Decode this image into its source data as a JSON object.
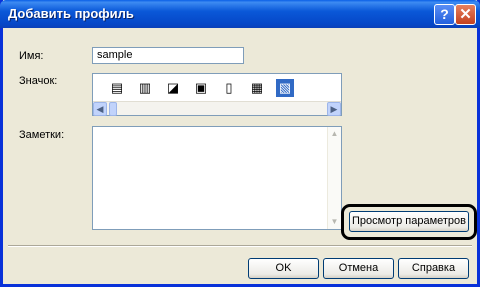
{
  "window": {
    "title": "Добавить профиль",
    "help_glyph": "?",
    "close_glyph": "✕"
  },
  "form": {
    "name_label": "Имя:",
    "name_value": "sample",
    "icon_label": "Значок:",
    "notes_label": "Заметки:",
    "notes_value": ""
  },
  "icons": [
    {
      "name": "profile-icon-1",
      "glyph": "▤"
    },
    {
      "name": "profile-icon-2",
      "glyph": "▥"
    },
    {
      "name": "profile-icon-3",
      "glyph": "◪"
    },
    {
      "name": "profile-icon-4",
      "glyph": "▣"
    },
    {
      "name": "profile-icon-5",
      "glyph": "▯"
    },
    {
      "name": "profile-icon-6",
      "glyph": "▦"
    },
    {
      "name": "profile-icon-7",
      "glyph": "▧",
      "selected": true
    }
  ],
  "buttons": {
    "preview": "Просмотр параметров",
    "ok": "OK",
    "cancel": "Отмена",
    "help": "Справка"
  },
  "colors": {
    "title_bar": "#0a58d8",
    "selection": "#316ac5",
    "highlight_ring": "#000000"
  }
}
